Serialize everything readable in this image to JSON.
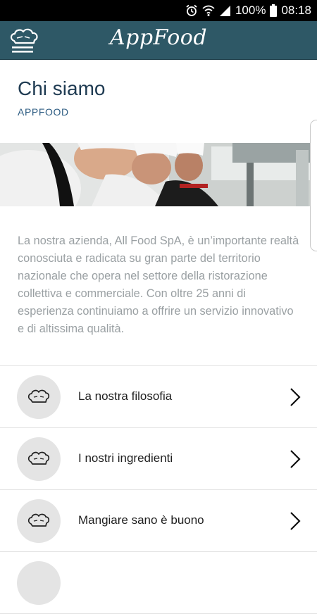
{
  "status_bar": {
    "battery": "100%",
    "time": "08:18",
    "icons": [
      "alarm-icon",
      "wifi-icon",
      "signal-icon",
      "battery-icon"
    ]
  },
  "app_bar": {
    "title": "AppFood",
    "background": "#2e5866"
  },
  "page": {
    "title": "Chi siamo",
    "subtitle": "APPFOOD",
    "description": "La nostra azienda, All Food SpA, è un’importante realtà conosciuta e radicata su gran parte del territorio nazionale che opera nel settore della ristorazione collettiva e commerciale. Con oltre 25 anni di esperienza continuiamo a offrire un servizio innovativo e di altissima qualità."
  },
  "menu_items": [
    {
      "label": "La nostra filosofia",
      "icon": "chef-hat-icon"
    },
    {
      "label": "I nostri ingredienti",
      "icon": "chef-hat-icon"
    },
    {
      "label": "Mangiare sano è buono",
      "icon": "chef-hat-icon"
    }
  ]
}
